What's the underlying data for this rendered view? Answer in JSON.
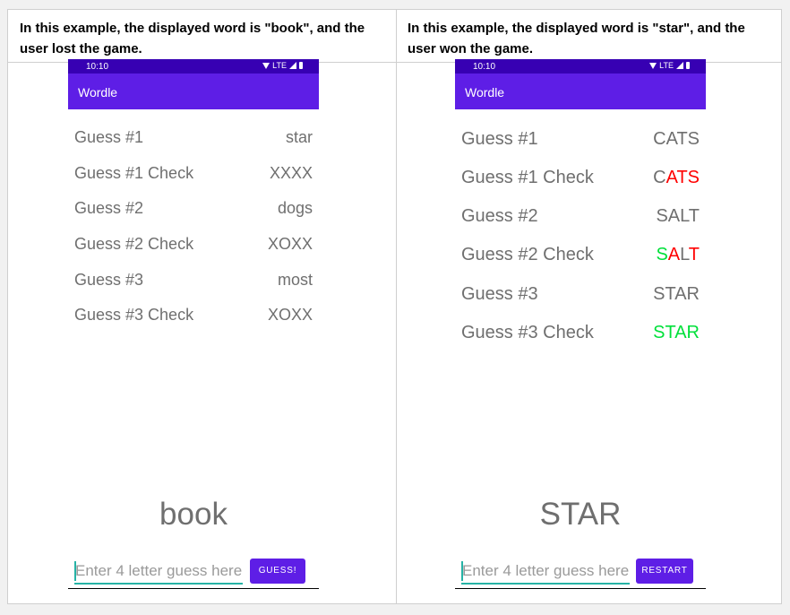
{
  "captions": {
    "left": "In this example, the displayed word is \"book\", and the user lost the game.",
    "right": "In this example, the displayed word is \"star\", and the user won the game."
  },
  "status": {
    "time": "10:10",
    "network": "LTE"
  },
  "app_title": "Wordle",
  "input_placeholder": "Enter 4 letter guess here",
  "left_phone": {
    "rows": [
      {
        "label": "Guess #1",
        "value": "star"
      },
      {
        "label": "Guess #1 Check",
        "value": "XXXX"
      },
      {
        "label": "Guess #2",
        "value": "dogs"
      },
      {
        "label": "Guess #2 Check",
        "value": "XOXX"
      },
      {
        "label": "Guess #3",
        "value": "most"
      },
      {
        "label": "Guess #3 Check",
        "value": "XOXX"
      }
    ],
    "word": "book",
    "button": "GUESS!"
  },
  "right_phone": {
    "rows": [
      {
        "label": "Guess #1",
        "value": "CATS"
      },
      {
        "label": "Guess #1 Check",
        "letters": [
          {
            "ch": "C",
            "color": "#6f6f6f"
          },
          {
            "ch": "A",
            "color": "#ff0000"
          },
          {
            "ch": "T",
            "color": "#ff0000"
          },
          {
            "ch": "S",
            "color": "#ff0000"
          }
        ]
      },
      {
        "label": "Guess #2",
        "value": "SALT"
      },
      {
        "label": "Guess #2 Check",
        "letters": [
          {
            "ch": "S",
            "color": "#00e03a"
          },
          {
            "ch": "A",
            "color": "#ff0000"
          },
          {
            "ch": "L",
            "color": "#6f6f6f"
          },
          {
            "ch": "T",
            "color": "#ff0000"
          }
        ]
      },
      {
        "label": "Guess #3",
        "value": "STAR"
      },
      {
        "label": "Guess #3 Check",
        "value": "STAR",
        "color": "#00e03a"
      }
    ],
    "word": "STAR",
    "button": "RESTART"
  },
  "colors": {
    "appbar": "#5e1ee6",
    "statusbar": "#3700b3",
    "accent_underline": "#26b3a6"
  }
}
